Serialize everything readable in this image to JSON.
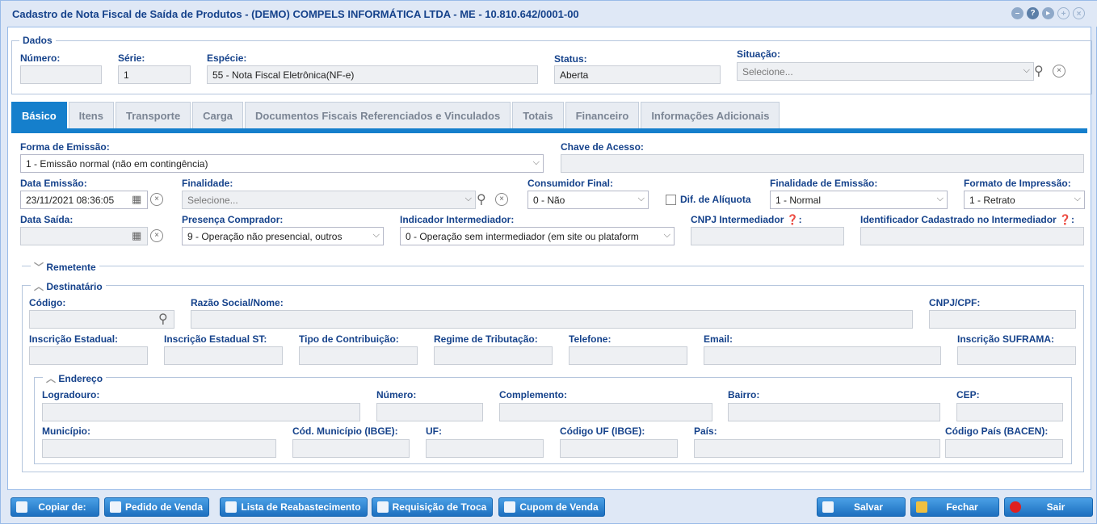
{
  "window": {
    "title": "Cadastro de Nota Fiscal de Saída de Produtos - (DEMO) COMPELS INFORMÁTICA LTDA - ME - 10.810.642/0001-00",
    "tool_icons": [
      "minimize-icon",
      "help-icon",
      "play-icon",
      "restore-icon",
      "close-icon"
    ]
  },
  "dados": {
    "legend": "Dados",
    "numero_label": "Número:",
    "numero_value": "",
    "serie_label": "Série:",
    "serie_value": "1",
    "especie_label": "Espécie:",
    "especie_value": "55 - Nota Fiscal Eletrônica(NF-e)",
    "status_label": "Status:",
    "status_value": "Aberta",
    "situacao_label": "Situação:",
    "situacao_placeholder": "Selecione..."
  },
  "tabs": [
    "Básico",
    "Itens",
    "Transporte",
    "Carga",
    "Documentos Fiscais Referenciados e Vinculados",
    "Totais",
    "Financeiro",
    "Informações Adicionais"
  ],
  "basico": {
    "forma_emissao_label": "Forma de Emissão:",
    "forma_emissao_value": "1 - Emissão normal (não em contingência)",
    "chave_acesso_label": "Chave de Acesso:",
    "chave_acesso_value": "",
    "data_emissao_label": "Data Emissão:",
    "data_emissao_value": "23/11/2021 08:36:05",
    "finalidade_label": "Finalidade:",
    "finalidade_placeholder": "Selecione...",
    "consumidor_final_label": "Consumidor Final:",
    "consumidor_final_value": "0 - Não",
    "dif_aliquota_label": "Dif. de Alíquota",
    "finalidade_emissao_label": "Finalidade de Emissão:",
    "finalidade_emissao_value": "1 - Normal",
    "formato_impressao_label": "Formato de Impressão:",
    "formato_impressao_value": "1 - Retrato",
    "data_saida_label": "Data Saída:",
    "data_saida_value": "",
    "presenca_label": "Presença Comprador:",
    "presenca_value": "9 - Operação não presencial, outros",
    "indicador_label": "Indicador Intermediador:",
    "indicador_value": "0 - Operação sem intermediador (em site ou plataform",
    "cnpj_intermediador_label": "CNPJ Intermediador",
    "identificador_label": "Identificador Cadastrado no Intermediador"
  },
  "remetente": {
    "legend": "Remetente"
  },
  "destinatario": {
    "legend": "Destinatário",
    "codigo_label": "Código:",
    "razao_label": "Razão Social/Nome:",
    "cnpj_label": "CNPJ/CPF:",
    "ie_label": "Inscrição Estadual:",
    "ie_st_label": "Inscrição Estadual ST:",
    "tipo_contrib_label": "Tipo de Contribuição:",
    "regime_label": "Regime de Tributação:",
    "telefone_label": "Telefone:",
    "email_label": "Email:",
    "suframa_label": "Inscrição SUFRAMA:"
  },
  "endereco": {
    "legend": "Endereço",
    "logradouro_label": "Logradouro:",
    "numero_label": "Número:",
    "complemento_label": "Complemento:",
    "bairro_label": "Bairro:",
    "cep_label": "CEP:",
    "municipio_label": "Município:",
    "cod_municipio_label": "Cód. Município (IBGE):",
    "uf_label": "UF:",
    "codigo_uf_label": "Código UF (IBGE):",
    "pais_label": "País:",
    "codigo_pais_label": "Código País (BACEN):"
  },
  "buttons": {
    "copiar": "Copiar de:",
    "pedido": "Pedido de Venda",
    "lista": "Lista de Reabastecimento",
    "requisicao": "Requisição de Troca",
    "cupom": "Cupom de Venda",
    "salvar": "Salvar",
    "fechar": "Fechar",
    "sair": "Sair"
  }
}
